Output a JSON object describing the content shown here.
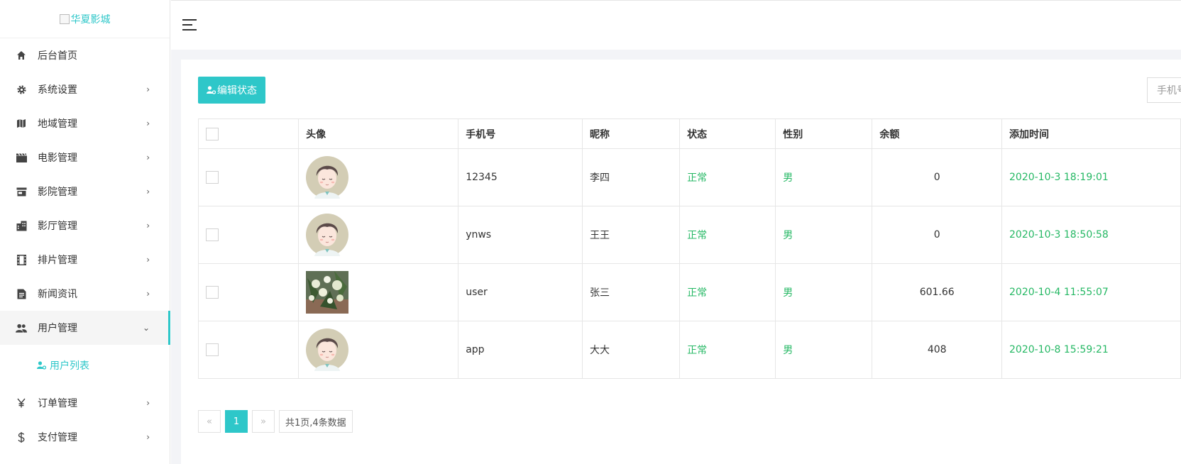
{
  "logo": {
    "alt": "华夏影城"
  },
  "sidebar": {
    "items": [
      {
        "label": "后台首页",
        "icon": "home-icon"
      },
      {
        "label": "系统设置",
        "icon": "gear-icon"
      },
      {
        "label": "地域管理",
        "icon": "map-icon"
      },
      {
        "label": "电影管理",
        "icon": "film-icon"
      },
      {
        "label": "影院管理",
        "icon": "store-icon"
      },
      {
        "label": "影厅管理",
        "icon": "building-icon"
      },
      {
        "label": "排片管理",
        "icon": "film-strip-icon"
      },
      {
        "label": "新闻资讯",
        "icon": "news-icon"
      },
      {
        "label": "用户管理",
        "icon": "users-icon"
      },
      {
        "label": "订单管理",
        "icon": "yen-icon"
      },
      {
        "label": "支付管理",
        "icon": "dollar-icon"
      }
    ],
    "sub": {
      "label": "用户列表",
      "icon": "user-settings-icon"
    },
    "expand_chevron": "›",
    "open_chevron": "⌄"
  },
  "toolbar": {
    "edit_label": "编辑状态",
    "search_placeholder": "手机号"
  },
  "table": {
    "headers": [
      "头像",
      "手机号",
      "昵称",
      "状态",
      "性别",
      "余额",
      "添加时间"
    ],
    "rows": [
      {
        "phone": "12345",
        "nick": "李四",
        "status": "正常",
        "gender": "男",
        "balance": "0",
        "time": "2020-10-3 18:19:01",
        "avatar": "cartoon-boy-avatar"
      },
      {
        "phone": "ynws",
        "nick": "王王",
        "status": "正常",
        "gender": "男",
        "balance": "0",
        "time": "2020-10-3 18:50:58",
        "avatar": "cartoon-boy-avatar"
      },
      {
        "phone": "user",
        "nick": "张三",
        "status": "正常",
        "gender": "男",
        "balance": "601.66",
        "time": "2020-10-4 11:55:07",
        "avatar": "flowers-photo-avatar"
      },
      {
        "phone": "app",
        "nick": "大大",
        "status": "正常",
        "gender": "男",
        "balance": "408",
        "time": "2020-10-8 15:59:21",
        "avatar": "cartoon-boy-avatar"
      }
    ]
  },
  "pager": {
    "prev": "«",
    "current": "1",
    "next": "»",
    "info": "共1页,4条数据"
  },
  "colors": {
    "accent": "#2ec7c9",
    "status_green": "#25b864"
  }
}
